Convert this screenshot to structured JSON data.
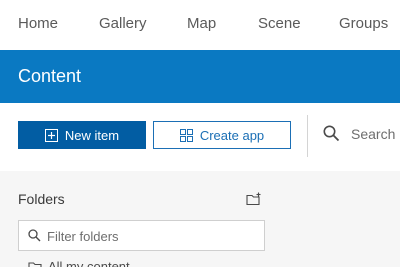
{
  "nav": {
    "items": [
      {
        "label": "Home"
      },
      {
        "label": "Gallery"
      },
      {
        "label": "Map"
      },
      {
        "label": "Scene"
      },
      {
        "label": "Groups"
      }
    ]
  },
  "banner": {
    "title": "Content",
    "color": "#0a79c2"
  },
  "toolbar": {
    "new_item_label": "New item",
    "create_app_label": "Create app",
    "search_placeholder": "Search",
    "primary_color": "#025da3"
  },
  "folders": {
    "heading": "Folders",
    "filter_placeholder": "Filter folders",
    "items": [
      {
        "label": "All my content"
      }
    ]
  }
}
